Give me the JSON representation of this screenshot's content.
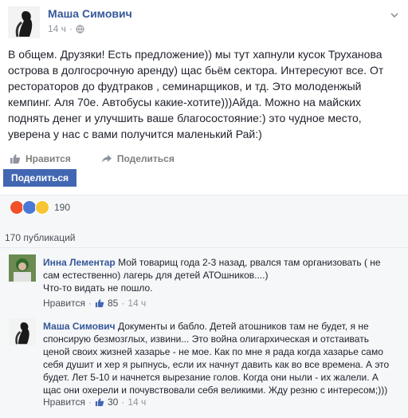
{
  "post": {
    "author": "Маша Симович",
    "time": "14 ч",
    "text": "В общем. Друзяки! Есть предложение)) мы тут хапнули кусок Труханова острова в долгосрочную аренду) щас бьём сектора. Интересуют все. От рестораторов до фудтраков , семинарщиков, и тд. Это молоденжый кемпинг. Аля 70е. Автобусы какие-хотите)))Айда. Можно на майских поднять денег и улучшить ваше благосостояние:) это чудное место, уверена у нас с вами получится маленький Рай:)",
    "like_label": "Нравится",
    "share_label": "Поделиться",
    "share_button_label": "Поделиться",
    "reaction_count": "190",
    "publications": "170 публикаций"
  },
  "comments": [
    {
      "author": "Инна Лементар",
      "text": "Мой товарищ года 2-3 назад, рвался там организовать ( не сам естественно) лагерь для детей АТОшников....)\nЧто-то видать не пошло.",
      "like_label": "Нравится",
      "likes": "85",
      "time": "14 ч"
    },
    {
      "author": "Маша Симович",
      "text": "Документы и бабло. Детей атошников там не будет, я не спонсирую безмозглых, извини... Это война олигархическая и отстаивать ценой своих жизней хазарье - не мое. Как по мне я рада когда хазарье само себя душит и хер я рыпнусь, если их начнут давить как во все времена. А это будет. Лет 5-10 и начнется вырезание голов. Когда они ныли - их жалели. А щас они охерели и почувствовали себя великими. Жду резню с интересом;)))",
      "like_label": "Нравится",
      "likes": "30",
      "time": "14 ч"
    }
  ],
  "colors": {
    "link": "#365899",
    "button": "#4267b2",
    "muted": "#90949c",
    "panel": "#f6f7f9"
  },
  "icons": [
    "chevron-down-icon",
    "globe-icon",
    "like-icon",
    "share-icon",
    "angry-reaction-icon",
    "like-reaction-icon",
    "haha-reaction-icon",
    "thumbs-up-small-icon"
  ]
}
